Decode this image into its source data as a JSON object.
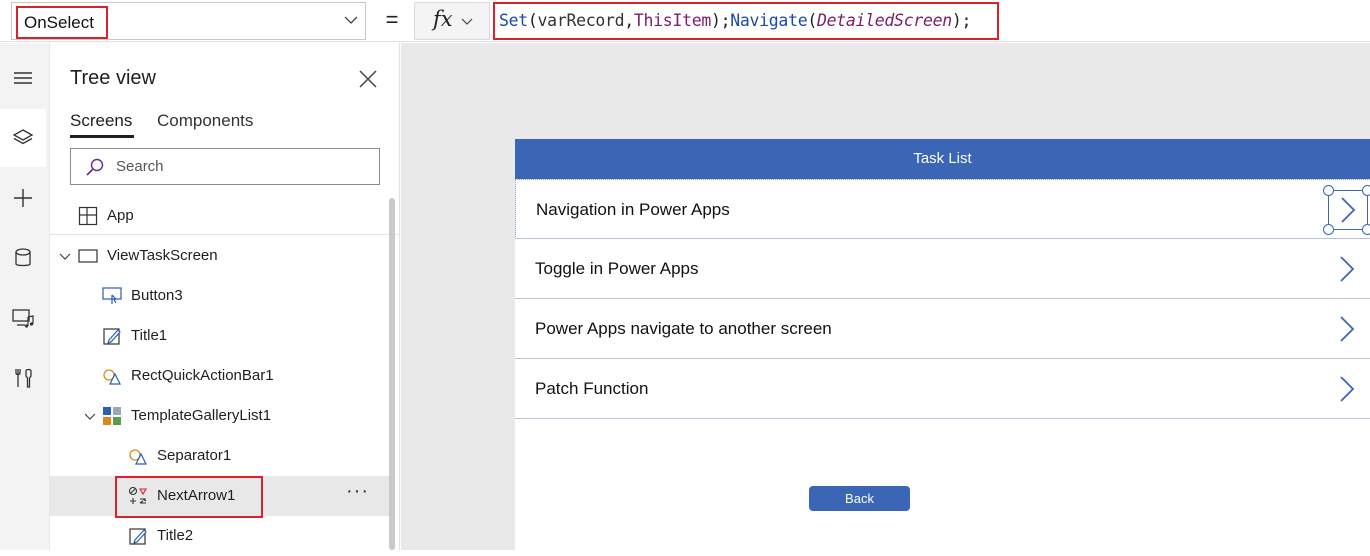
{
  "formula_bar": {
    "property": "OnSelect",
    "equals": "=",
    "fx_label": "fx",
    "formula": {
      "set": "Set",
      "open1": "(",
      "var": "varRecord",
      "comma": ",",
      "this_item": "ThisItem",
      "close1": ");",
      "navigate": "Navigate",
      "open2": "(",
      "screen": "DetailedScreen",
      "close2": ");"
    }
  },
  "rail": {
    "items": [
      "hamburger-icon",
      "layers-icon",
      "plus-icon",
      "database-icon",
      "media-icon",
      "tools-icon"
    ]
  },
  "tree": {
    "title": "Tree view",
    "tabs": [
      "Screens",
      "Components"
    ],
    "search_placeholder": "Search",
    "nodes": {
      "app": "App",
      "screen": "ViewTaskScreen",
      "button3": "Button3",
      "title1": "Title1",
      "rect": "RectQuickActionBar1",
      "gallery": "TemplateGalleryList1",
      "separator": "Separator1",
      "next_arrow": "NextArrow1",
      "title2": "Title2"
    },
    "more": "···"
  },
  "canvas": {
    "header": "Task List",
    "items": [
      "Navigation in Power Apps",
      "Toggle in Power Apps",
      "Power Apps navigate to another screen",
      "Patch Function"
    ],
    "back_button": "Back"
  },
  "colors": {
    "accent_blue": "#3b66b6",
    "highlight_red": "#d9222c"
  }
}
